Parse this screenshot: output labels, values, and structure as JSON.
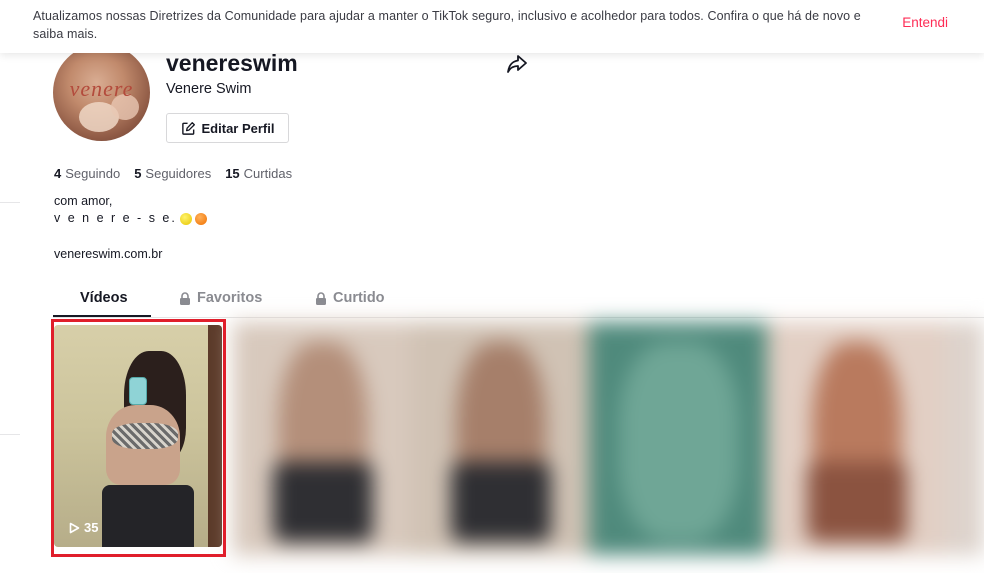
{
  "banner": {
    "message": "Atualizamos nossas Diretrizes da Comunidade para ajudar a manter o TikTok seguro, inclusivo e acolhedor para todos. Confira o que há de novo e saiba mais.",
    "dismiss_label": "Entendi"
  },
  "profile": {
    "avatar_text": "venere",
    "username": "venereswim",
    "nickname": "Venere Swim",
    "edit_label": "Editar Perfil"
  },
  "stats": [
    {
      "count": "4",
      "label": "Seguindo"
    },
    {
      "count": "5",
      "label": "Seguidores"
    },
    {
      "count": "15",
      "label": "Curtidas"
    }
  ],
  "bio": {
    "line1": "com amor,",
    "line2": "v e n e r e - s e."
  },
  "link": "venereswim.com.br",
  "tabs": [
    {
      "label": "Vídeos",
      "active": true
    },
    {
      "label": "Favoritos",
      "active": false,
      "locked": true
    },
    {
      "label": "Curtido",
      "active": false,
      "locked": true
    }
  ],
  "videos": [
    {
      "views": "35"
    }
  ],
  "colors": {
    "accent": "#fe2c55",
    "highlight": "#e01e2b",
    "text": "#161823"
  }
}
